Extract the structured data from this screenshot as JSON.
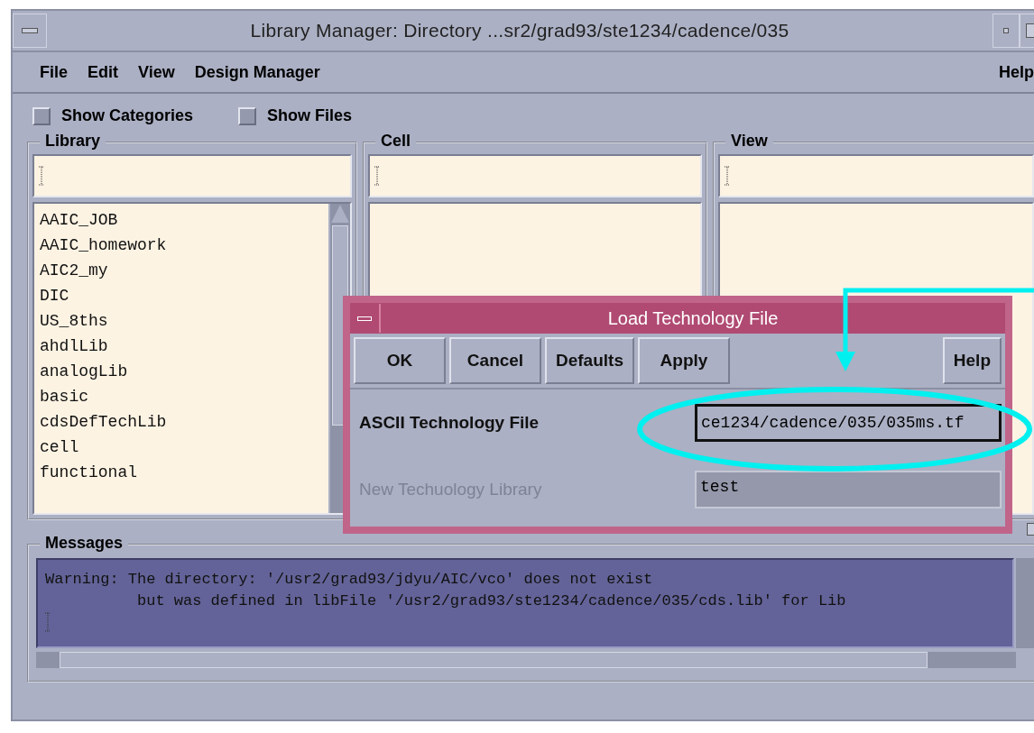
{
  "window": {
    "title": "Library Manager: Directory ...sr2/grad93/ste1234/cadence/035"
  },
  "menu": [
    "File",
    "Edit",
    "View",
    "Design Manager"
  ],
  "menu_right": "Help",
  "options": [
    {
      "label": "Show Categories",
      "checked": false
    },
    {
      "label": "Show Files",
      "checked": false
    }
  ],
  "columns": [
    {
      "title": "Library",
      "items": [
        "AAIC_JOB",
        "AAIC_homework",
        "AIC2_my",
        "DIC",
        "US_8ths",
        "ahdlLib",
        "analogLib",
        "basic",
        "cdsDefTechLib",
        "cell",
        "functional"
      ]
    },
    {
      "title": "Cell"
    },
    {
      "title": "View"
    }
  ],
  "messages": {
    "title": "Messages",
    "lines": [
      "Warning: The directory: '/usr2/grad93/jdyu/AIC/vco' does not exist",
      "but was defined in libFile '/usr2/grad93/ste1234/cadence/035/cds.lib' for Lib"
    ]
  },
  "dialog": {
    "title": "Load Technology File",
    "buttons": [
      "OK",
      "Cancel",
      "Defaults",
      "Apply"
    ],
    "help": "Help",
    "fields": [
      {
        "label": "ASCII Technology File",
        "value": "ce1234/cadence/035/035ms.tf",
        "disabled": false
      },
      {
        "label": "New Techuology Library",
        "value": "test",
        "disabled": true
      }
    ]
  }
}
